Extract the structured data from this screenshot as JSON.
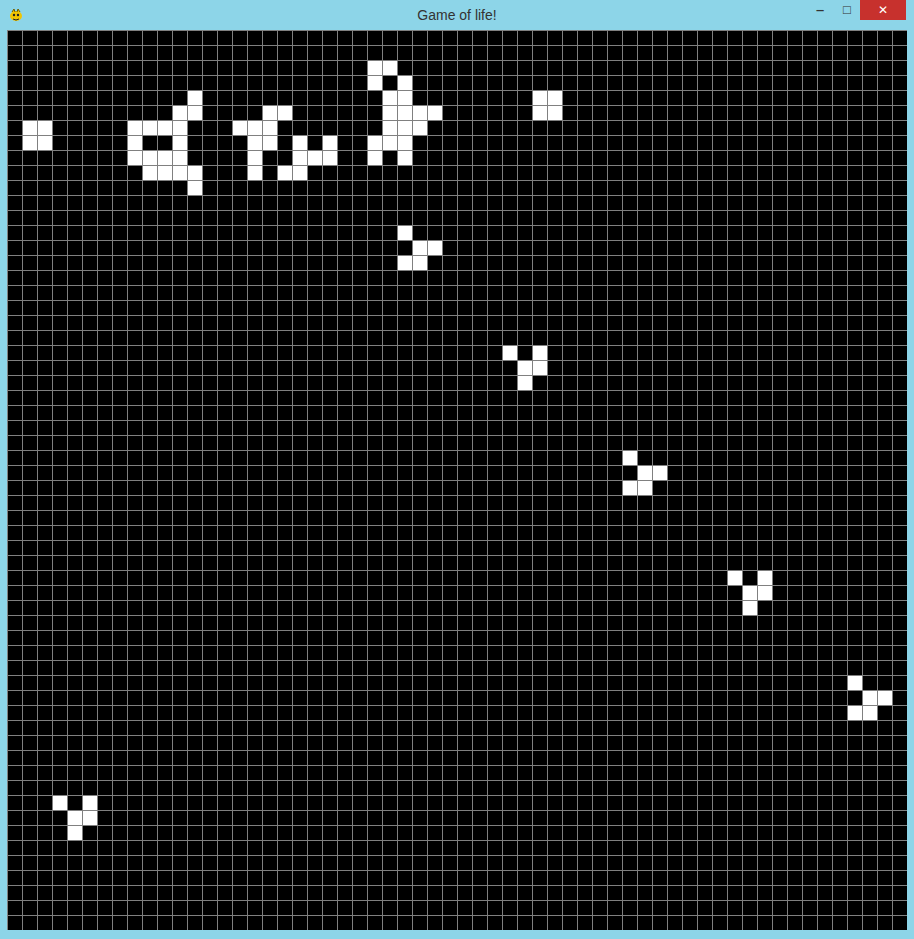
{
  "window": {
    "title": "Game of life!",
    "buttons": [
      {
        "name": "minimize",
        "glyph": "‒"
      },
      {
        "name": "maximize",
        "glyph": "□"
      },
      {
        "name": "close",
        "glyph": "✕"
      }
    ]
  },
  "board": {
    "rows": 60,
    "columns": 60,
    "live_cells": [
      {
        "row": 6,
        "col": 1
      },
      {
        "row": 6,
        "col": 2
      },
      {
        "row": 7,
        "col": 1
      },
      {
        "row": 7,
        "col": 2
      },
      {
        "row": 4,
        "col": 35
      },
      {
        "row": 4,
        "col": 36
      },
      {
        "row": 5,
        "col": 35
      },
      {
        "row": 5,
        "col": 36
      },
      {
        "row": 4,
        "col": 12
      },
      {
        "row": 5,
        "col": 11
      },
      {
        "row": 5,
        "col": 12
      },
      {
        "row": 6,
        "col": 8
      },
      {
        "row": 6,
        "col": 9
      },
      {
        "row": 6,
        "col": 10
      },
      {
        "row": 6,
        "col": 11
      },
      {
        "row": 7,
        "col": 8
      },
      {
        "row": 7,
        "col": 11
      },
      {
        "row": 8,
        "col": 8
      },
      {
        "row": 8,
        "col": 9
      },
      {
        "row": 8,
        "col": 10
      },
      {
        "row": 8,
        "col": 11
      },
      {
        "row": 9,
        "col": 9
      },
      {
        "row": 9,
        "col": 10
      },
      {
        "row": 9,
        "col": 11
      },
      {
        "row": 9,
        "col": 12
      },
      {
        "row": 10,
        "col": 12
      },
      {
        "row": 5,
        "col": 17
      },
      {
        "row": 5,
        "col": 18
      },
      {
        "row": 6,
        "col": 15
      },
      {
        "row": 6,
        "col": 16
      },
      {
        "row": 6,
        "col": 17
      },
      {
        "row": 7,
        "col": 16
      },
      {
        "row": 7,
        "col": 17
      },
      {
        "row": 7,
        "col": 19
      },
      {
        "row": 7,
        "col": 21
      },
      {
        "row": 8,
        "col": 16
      },
      {
        "row": 8,
        "col": 19
      },
      {
        "row": 8,
        "col": 20
      },
      {
        "row": 8,
        "col": 21
      },
      {
        "row": 9,
        "col": 16
      },
      {
        "row": 9,
        "col": 18
      },
      {
        "row": 9,
        "col": 19
      },
      {
        "row": 2,
        "col": 24
      },
      {
        "row": 2,
        "col": 25
      },
      {
        "row": 3,
        "col": 24
      },
      {
        "row": 3,
        "col": 26
      },
      {
        "row": 4,
        "col": 25
      },
      {
        "row": 4,
        "col": 26
      },
      {
        "row": 5,
        "col": 25
      },
      {
        "row": 5,
        "col": 26
      },
      {
        "row": 5,
        "col": 27
      },
      {
        "row": 5,
        "col": 28
      },
      {
        "row": 6,
        "col": 25
      },
      {
        "row": 6,
        "col": 26
      },
      {
        "row": 6,
        "col": 27
      },
      {
        "row": 7,
        "col": 24
      },
      {
        "row": 7,
        "col": 25
      },
      {
        "row": 7,
        "col": 26
      },
      {
        "row": 8,
        "col": 24
      },
      {
        "row": 8,
        "col": 26
      },
      {
        "row": 13,
        "col": 26
      },
      {
        "row": 14,
        "col": 27
      },
      {
        "row": 14,
        "col": 28
      },
      {
        "row": 15,
        "col": 26
      },
      {
        "row": 15,
        "col": 27
      },
      {
        "row": 21,
        "col": 33
      },
      {
        "row": 21,
        "col": 35
      },
      {
        "row": 22,
        "col": 34
      },
      {
        "row": 22,
        "col": 35
      },
      {
        "row": 23,
        "col": 34
      },
      {
        "row": 28,
        "col": 41
      },
      {
        "row": 29,
        "col": 42
      },
      {
        "row": 29,
        "col": 43
      },
      {
        "row": 30,
        "col": 41
      },
      {
        "row": 30,
        "col": 42
      },
      {
        "row": 36,
        "col": 48
      },
      {
        "row": 36,
        "col": 50
      },
      {
        "row": 37,
        "col": 49
      },
      {
        "row": 37,
        "col": 50
      },
      {
        "row": 38,
        "col": 49
      },
      {
        "row": 43,
        "col": 56
      },
      {
        "row": 44,
        "col": 57
      },
      {
        "row": 44,
        "col": 58
      },
      {
        "row": 45,
        "col": 56
      },
      {
        "row": 45,
        "col": 57
      },
      {
        "row": 51,
        "col": 3
      },
      {
        "row": 51,
        "col": 5
      },
      {
        "row": 52,
        "col": 4
      },
      {
        "row": 52,
        "col": 5
      },
      {
        "row": 53,
        "col": 4
      }
    ]
  }
}
